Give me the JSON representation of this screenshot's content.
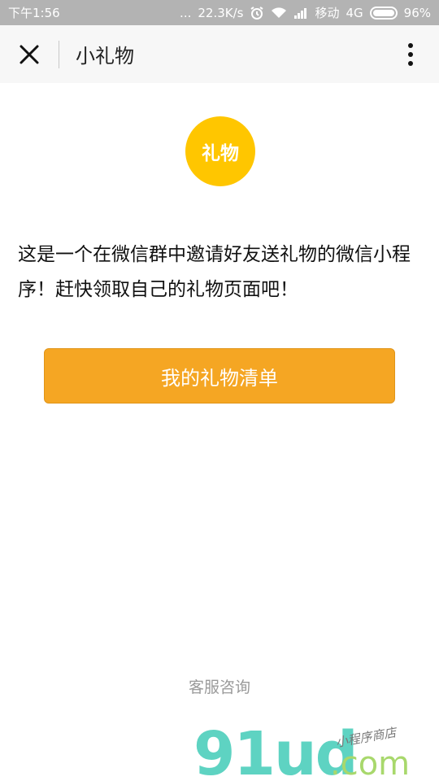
{
  "status_bar": {
    "time": "下午1:56",
    "dots": "...",
    "network_speed": "22.3K/s",
    "carrier": "移动",
    "network_type": "4G",
    "battery": "96%"
  },
  "nav": {
    "title": "小礼物"
  },
  "badge": {
    "label": "礼物",
    "color": "#ffc600"
  },
  "intro": {
    "text": "这是一个在微信群中邀请好友送礼物的微信小程序！赶快领取自己的礼物页面吧！"
  },
  "primary_button": {
    "label": "我的礼物清单",
    "color": "#f5a623"
  },
  "footer": {
    "customer_service": "客服咨询"
  },
  "watermark": {
    "brand": "91ud",
    "domain": ".com",
    "tagline": "小程序商店"
  }
}
